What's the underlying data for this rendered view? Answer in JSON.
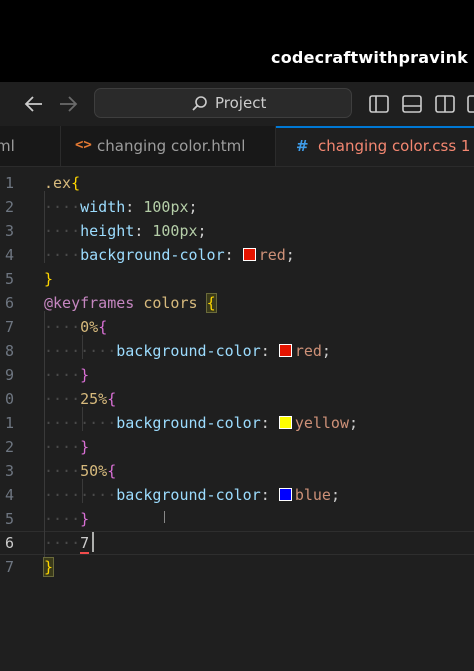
{
  "watermark": "codecraftwithpravink",
  "titlebar": {
    "search_label": "Project"
  },
  "tabs": [
    {
      "label": "ml",
      "icon": "",
      "active": false
    },
    {
      "label": "changing color.html",
      "icon": "<>",
      "active": false
    },
    {
      "label": "changing color.css 1",
      "icon": "#",
      "active": true
    }
  ],
  "gutter": [
    "1",
    "2",
    "3",
    "4",
    "5",
    "6",
    "7",
    "8",
    "9",
    "0",
    "1",
    "2",
    "3",
    "4",
    "5",
    "6",
    "7"
  ],
  "code": {
    "l1": {
      "sel": ".ex",
      "open": "{"
    },
    "l2": {
      "prop": "width",
      "colon": ": ",
      "num": "100",
      "unit": "px",
      "semi": ";"
    },
    "l3": {
      "prop": "height",
      "colon": ": ",
      "num": "100",
      "unit": "px",
      "semi": ";"
    },
    "l4": {
      "prop": "background-color",
      "colon": ": ",
      "val": "red",
      "semi": ";",
      "swatch": "#e51400"
    },
    "l5": {
      "close": "}"
    },
    "l6": {
      "at": "@keyframes",
      "name": " colors ",
      "open": "{"
    },
    "l7": {
      "pct": "0%",
      "open": "{"
    },
    "l8": {
      "prop": "background-color",
      "colon": ": ",
      "val": "red",
      "semi": ";",
      "swatch": "#e51400"
    },
    "l9": {
      "close": "}"
    },
    "l10": {
      "pct": "25%",
      "open": "{"
    },
    "l11": {
      "prop": "background-color",
      "colon": ": ",
      "val": "yellow",
      "semi": ";",
      "swatch": "#ffff00"
    },
    "l12": {
      "close": "}"
    },
    "l13": {
      "pct": "50%",
      "open": "{"
    },
    "l14": {
      "prop": "background-color",
      "colon": ": ",
      "val": "blue",
      "semi": ";",
      "swatch": "#0000ff"
    },
    "l15": {
      "close": "}"
    },
    "l16": {
      "typed": "7"
    },
    "l17": {
      "close": "}"
    }
  },
  "colors": {
    "accent": "#0078d4",
    "editor_bg": "#1f1f1f",
    "error_tab": "#f48771"
  }
}
